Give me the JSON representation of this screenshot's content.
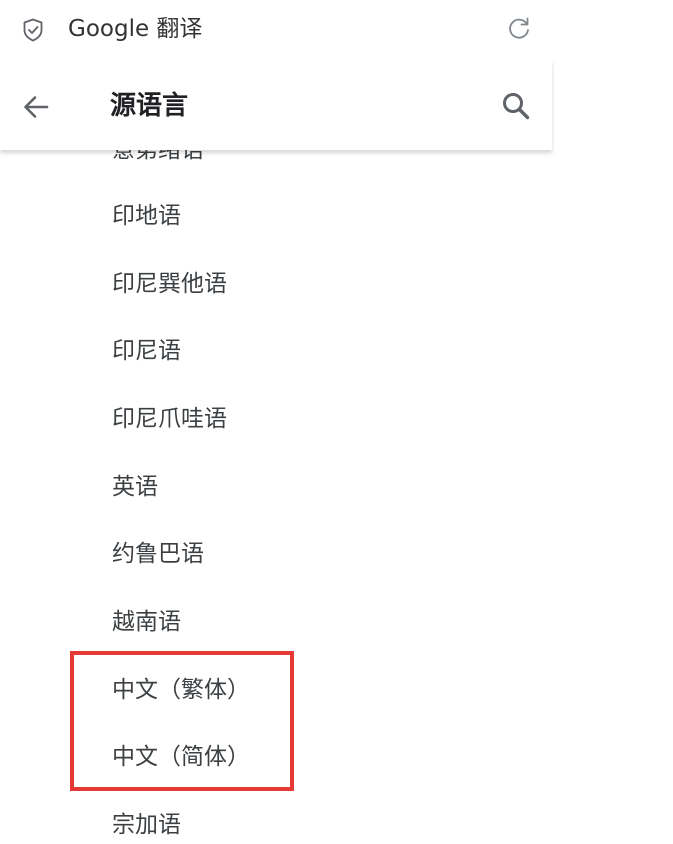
{
  "top_bar": {
    "app_title": "Google 翻译",
    "shield_icon": "shield-check-icon",
    "refresh_icon": "refresh-icon"
  },
  "header": {
    "title": "源语言",
    "back_icon": "arrow-left-icon",
    "search_icon": "search-icon"
  },
  "languages": [
    "意第绪语",
    "印地语",
    "印尼巽他语",
    "印尼语",
    "印尼爪哇语",
    "英语",
    "约鲁巴语",
    "越南语",
    "中文（繁体）",
    "中文（简体）",
    "宗加语"
  ],
  "colors": {
    "highlight": "#e53935",
    "text": "#3c4043"
  }
}
